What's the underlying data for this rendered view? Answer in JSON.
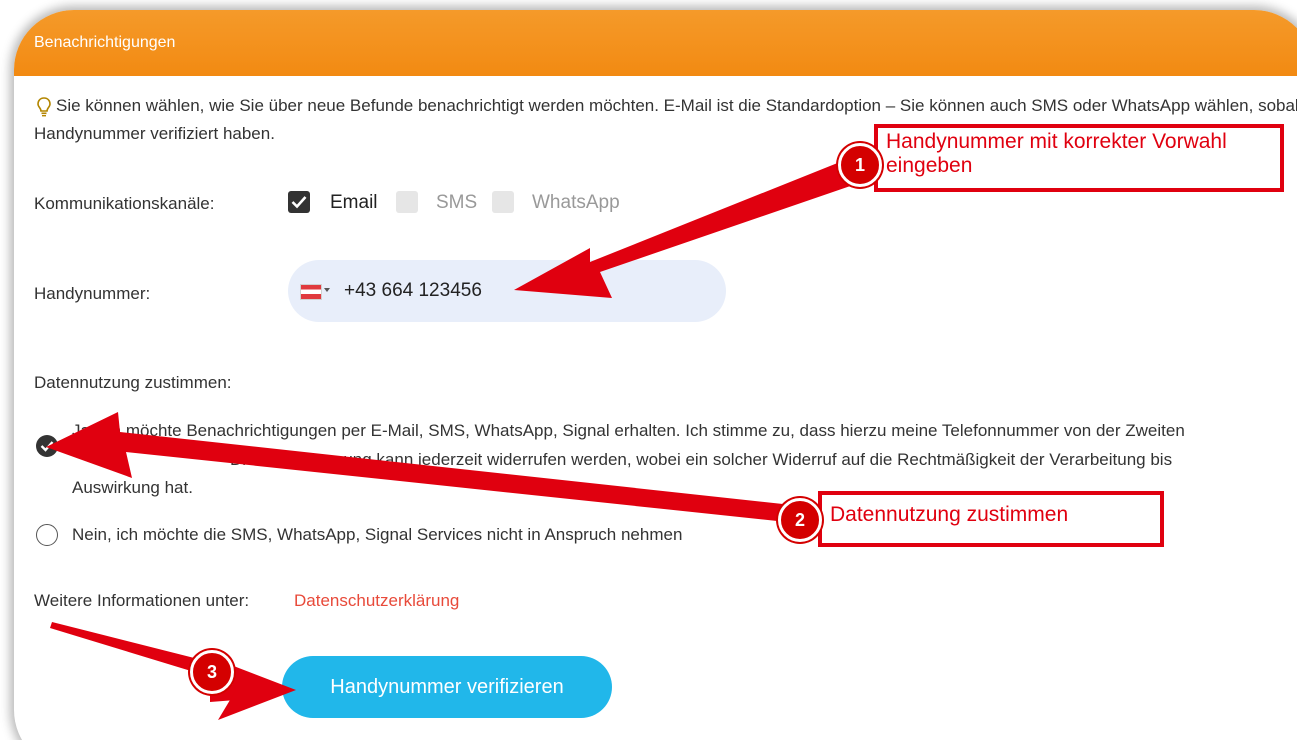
{
  "header": {
    "title": "Benachrichtigungen"
  },
  "info": {
    "line1": "Sie können wählen, wie Sie über neue Befunde benachrichtigt werden möchten. E-Mail ist die Standardoption – Sie können auch SMS oder WhatsApp wählen, sobald Sie Ihre",
    "line2": "Handynummer verifiziert haben."
  },
  "channels": {
    "label": "Kommunikationskanäle:",
    "options": [
      {
        "label": "Email",
        "checked": true
      },
      {
        "label": "SMS",
        "checked": false
      },
      {
        "label": "WhatsApp",
        "checked": false
      }
    ]
  },
  "phone": {
    "label": "Handynummer:",
    "value": "+43 664 123456",
    "country": "AT"
  },
  "consent": {
    "label": "Datennutzung zustimmen:",
    "yes_line1": "Ja, ich möchte Benachrichtigungen per E-Mail, SMS, WhatsApp, Signal erhalten. Ich stimme zu, dass hierzu meine Telefonnummer von der Zweiten",
    "yes_line2": "Diese Zustimmung kann jederzeit widerrufen werden, wobei ein solcher Widerruf auf die Rechtmäßigkeit der Verarbeitung bis",
    "yes_line3": "Auswirkung hat.",
    "no_label": "Nein, ich möchte die SMS, WhatsApp, Signal Services nicht in Anspruch nehmen"
  },
  "more_info": {
    "prefix": "Weitere Informationen unter:",
    "link": "Datenschutzerklärung"
  },
  "verify_button": {
    "label": "Handynummer verifizieren"
  },
  "annotations": [
    {
      "number": "1",
      "line1": "Handynummer mit korrekter Vorwahl",
      "line2": "eingeben"
    },
    {
      "number": "2",
      "text": "Datennutzung zustimmen"
    },
    {
      "number": "3"
    }
  ],
  "colors": {
    "header": "#f28a12",
    "accent_button": "#21b7ea",
    "link": "#e84a3a",
    "annotation_red": "#e0000f",
    "phone_box": "#e8eefa"
  }
}
